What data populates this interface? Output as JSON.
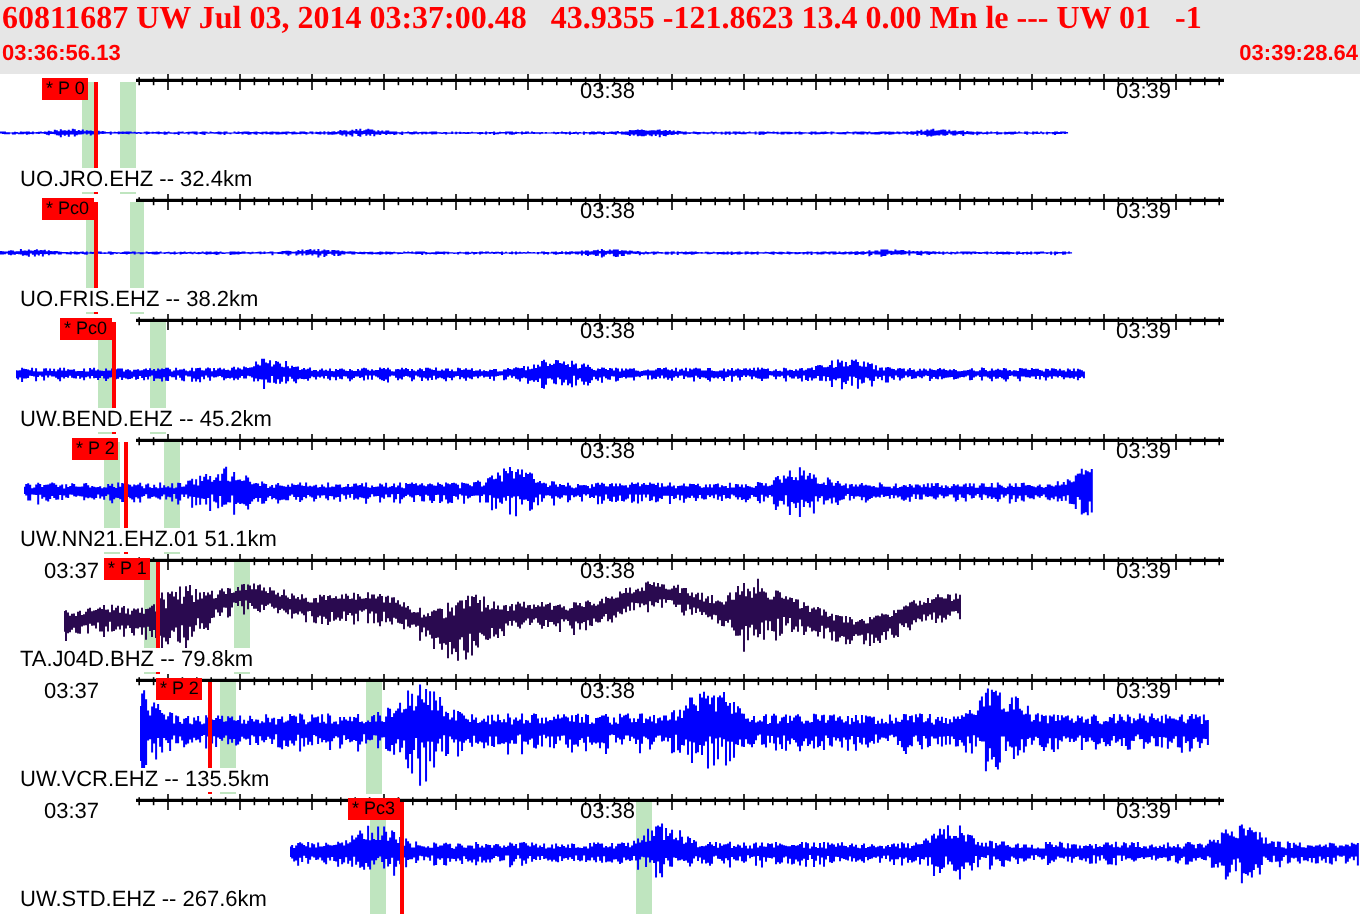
{
  "header": {
    "title": "60811687 UW Jul 03, 2014 03:37:00.48   43.9355 -121.8623 13.4 0.00 Mn le --- UW 01   -1",
    "start_time": "03:36:56.13",
    "end_time": "03:39:28.64"
  },
  "traces": [
    {
      "label": "UO.JRO.EHZ -- 32.4km",
      "pick": "* P 0",
      "color": "#0000ff",
      "time_labels": [
        "03:38",
        "03:39"
      ]
    },
    {
      "label": "UO.FRIS.EHZ -- 38.2km",
      "pick": "* Pc0",
      "color": "#0000ff",
      "time_labels": [
        "03:38",
        "03:39"
      ]
    },
    {
      "label": "UW.BEND.EHZ -- 45.2km",
      "pick": "* Pc0",
      "color": "#0000ff",
      "time_labels": [
        "03:38",
        "03:39"
      ]
    },
    {
      "label": "UW.NN21.EHZ.01 51.1km",
      "pick": "* P 2",
      "color": "#0000ff",
      "time_labels": [
        "03:38",
        "03:39"
      ]
    },
    {
      "label": "TA.J04D.BHZ -- 79.8km",
      "pick": "* P 1",
      "color": "#2a0a50",
      "time_labels": [
        "03:37",
        "03:38",
        "03:39"
      ]
    },
    {
      "label": "UW.VCR.EHZ -- 135.5km",
      "pick": "* P 2",
      "color": "#0000ff",
      "time_labels": [
        "03:37",
        "03:38",
        "03:39"
      ]
    },
    {
      "label": "UW.STD.EHZ -- 267.6km",
      "pick": "* Pc3",
      "color": "#0000ff",
      "time_labels": [
        "03:37",
        "03:38",
        "03:39"
      ]
    }
  ]
}
